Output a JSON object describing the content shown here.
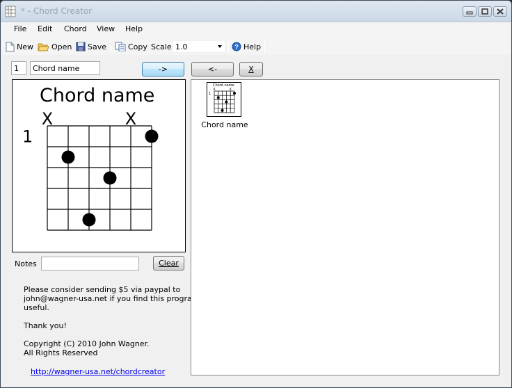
{
  "window": {
    "title": "* - Chord Creator",
    "controls": [
      "minimize",
      "maximize",
      "close"
    ]
  },
  "menu": [
    {
      "label": "File",
      "mnemonic": "F"
    },
    {
      "label": "Edit",
      "mnemonic": "E"
    },
    {
      "label": "Chord",
      "mnemonic": "C"
    },
    {
      "label": "View",
      "mnemonic": "V"
    },
    {
      "label": "Help",
      "mnemonic": "H"
    }
  ],
  "toolbar": {
    "new_label": "New",
    "open_label": "Open",
    "save_label": "Save",
    "copy_label": "Copy",
    "scale_label": "Scale",
    "scale_value": "1.0",
    "help_label": "Help"
  },
  "editor": {
    "position_value": "1",
    "name_value": "Chord name",
    "add_button": "->",
    "remove_button": "<-",
    "clear_list_button": "X"
  },
  "diagram": {
    "title": "Chord name",
    "start_fret_label": "1",
    "strings": 6,
    "frets": 5,
    "muted_strings": [
      1,
      5
    ],
    "muted_marker": "X",
    "dots": [
      {
        "string": 6,
        "fret": 1
      },
      {
        "string": 2,
        "fret": 2
      },
      {
        "string": 4,
        "fret": 3
      },
      {
        "string": 3,
        "fret": 5
      }
    ]
  },
  "notes": {
    "label": "Notes",
    "value": "",
    "clear_button": "Clear"
  },
  "info": {
    "donate_line1": "Please consider sending $5 via paypal to",
    "donate_line2": "john@wagner-usa.net if you find this program",
    "donate_line3": "useful.",
    "thanks": "Thank you!",
    "copyright_line1": "Copyright (C) 2010 John Wagner.",
    "copyright_line2": "All Rights Reserved",
    "link": "http://wagner-usa.net/chordcreator"
  },
  "chord_list": [
    {
      "label": "Chord name"
    }
  ]
}
